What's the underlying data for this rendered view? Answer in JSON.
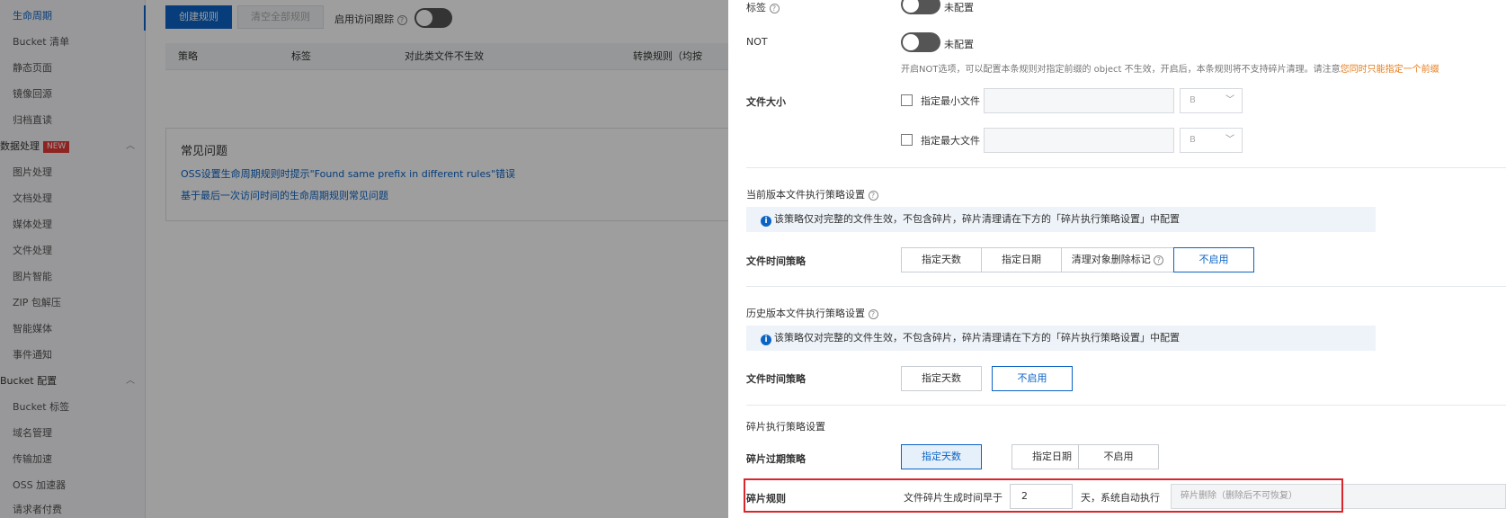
{
  "sidebar": {
    "items": [
      {
        "label": "生命周期"
      },
      {
        "label": "Bucket 清单"
      },
      {
        "label": "静态页面"
      },
      {
        "label": "镜像回源"
      },
      {
        "label": "归档直读"
      },
      {
        "label": "数据处理"
      },
      {
        "label": "图片处理"
      },
      {
        "label": "文档处理"
      },
      {
        "label": "媒体处理"
      },
      {
        "label": "文件处理"
      },
      {
        "label": "图片智能"
      },
      {
        "label": "ZIP 包解压"
      },
      {
        "label": "智能媒体"
      },
      {
        "label": "事件通知"
      },
      {
        "label": "Bucket 配置"
      },
      {
        "label": "Bucket 标签"
      },
      {
        "label": "域名管理"
      },
      {
        "label": "传输加速"
      },
      {
        "label": "OSS 加速器"
      },
      {
        "label": "请求者付费"
      }
    ],
    "new_badge": "NEW"
  },
  "main": {
    "create_rule": "创建规则",
    "clear_rules": "清空全部规则",
    "access_tracking_label": "启用访问跟踪",
    "table_headers": [
      "策略",
      "标签",
      "对此类文件不生效",
      "转换规则（均按"
    ],
    "faq_title": "常见问题",
    "faq_links": [
      "OSS设置生命周期规则时提示\"Found same prefix in different rules\"错误",
      "基于最后一次访问时间的生命周期规则常见问题"
    ]
  },
  "drawer": {
    "tag_label": "标签",
    "tag_status": "未配置",
    "not_label": "NOT",
    "not_status": "未配置",
    "not_hint": "开启NOT选项，可以配置本条规则对指定前缀的 object 不生效，开启后，本条规则将不支持碎片清理。请注意",
    "not_hint_warning": "您同时只能指定一个前缀",
    "file_size_label": "文件大小",
    "min_file_label": "指定最小文件",
    "max_file_label": "指定最大文件",
    "unit_min": "B",
    "unit_max": "B",
    "current_section": "当前版本文件执行策略设置",
    "current_info": "该策略仅对完整的文件生效，不包含碎片，碎片清理请在下方的「碎片执行策略设置」中配置",
    "current_time_label": "文件时间策略",
    "current_options": [
      "指定天数",
      "指定日期",
      "清理对象删除标记",
      "不启用"
    ],
    "history_section": "历史版本文件执行策略设置",
    "history_info": "该策略仅对完整的文件生效，不包含碎片，碎片清理请在下方的「碎片执行策略设置」中配置",
    "history_time_label": "文件时间策略",
    "history_options": [
      "指定天数",
      "不启用"
    ],
    "fragment_section": "碎片执行策略设置",
    "fragment_expire_label": "碎片过期策略",
    "fragment_options": [
      "指定天数",
      "指定日期",
      "不启用"
    ],
    "fragment_rule_label": "碎片规则",
    "fragment_prefix_text": "文件碎片生成时间早于",
    "fragment_days": "2",
    "fragment_suffix_text": "天，系统自动执行",
    "fragment_action": "碎片删除（删除后不可恢复）"
  },
  "colors": {
    "primary": "#0b63c5",
    "highlight_frame": "#d9262c",
    "warning": "#e47c1c"
  }
}
